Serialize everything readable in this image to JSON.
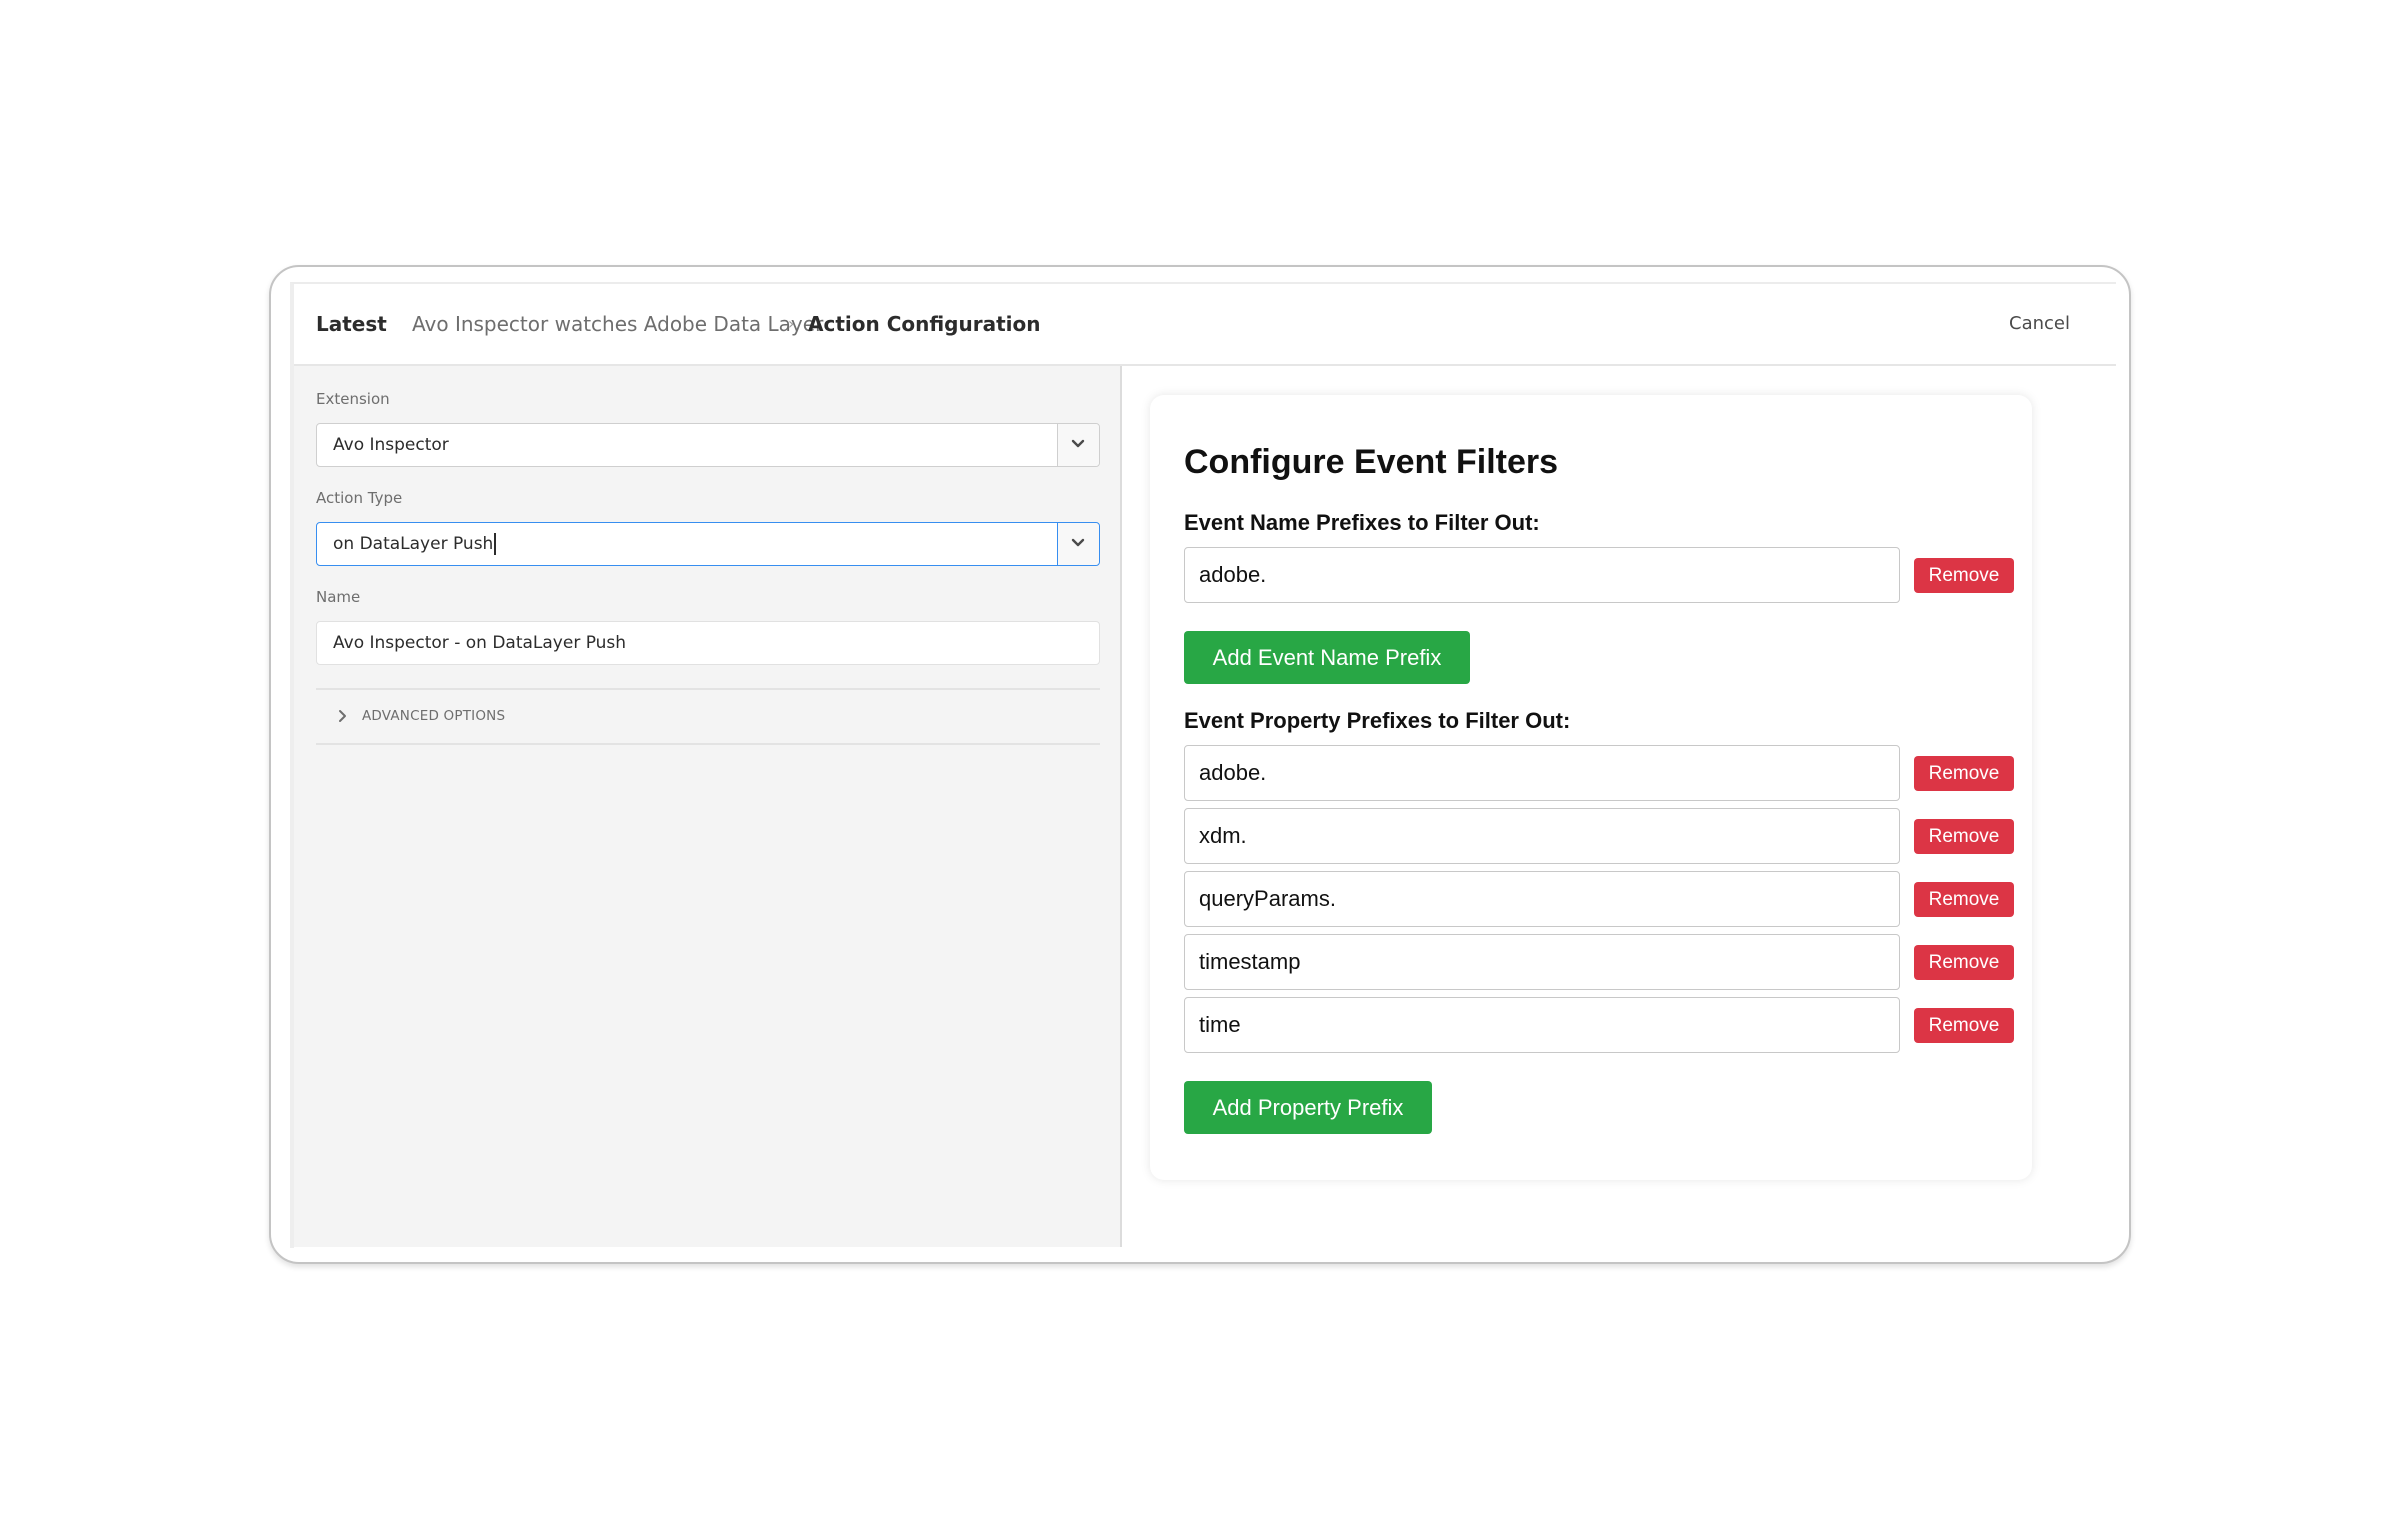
{
  "header": {
    "breadcrumb": {
      "root": "Latest",
      "parent": "Avo Inspector watches Adobe Data Layer",
      "separator": "›",
      "current": "Action Configuration"
    },
    "cancel_label": "Cancel"
  },
  "left_panel": {
    "extension": {
      "label": "Extension",
      "value": "Avo Inspector"
    },
    "action_type": {
      "label": "Action Type",
      "value": "on DataLayer Push"
    },
    "name": {
      "label": "Name",
      "value": "Avo Inspector - on DataLayer Push"
    },
    "advanced_options_label": "ADVANCED OPTIONS"
  },
  "card": {
    "title": "Configure Event Filters",
    "event_name_section": {
      "label": "Event Name Prefixes to Filter Out:",
      "prefixes": [
        "adobe."
      ],
      "add_label": "Add Event Name Prefix"
    },
    "event_property_section": {
      "label": "Event Property Prefixes to Filter Out:",
      "prefixes": [
        "adobe.",
        "xdm.",
        "queryParams.",
        "timestamp",
        "time"
      ],
      "add_label": "Add Property Prefix"
    },
    "remove_label": "Remove"
  },
  "colors": {
    "remove": "#dc3545",
    "add": "#28a745",
    "focus": "#378ef0"
  }
}
